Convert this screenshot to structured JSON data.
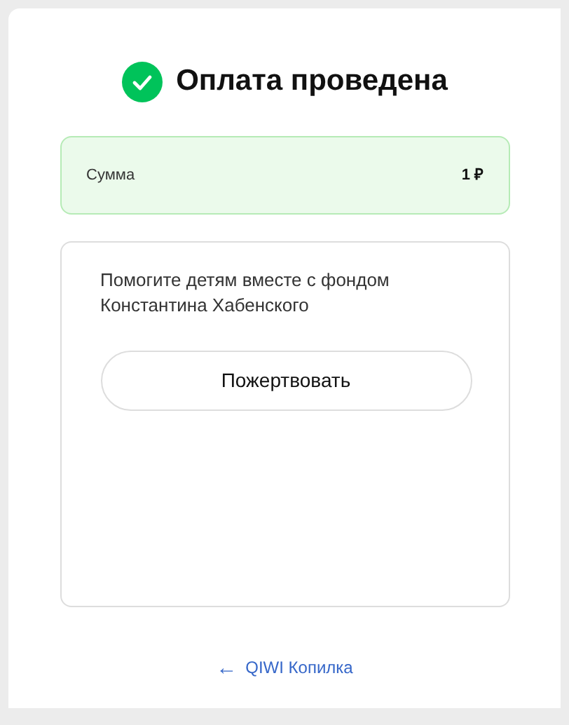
{
  "title": "Оплата проведена",
  "summary": {
    "label": "Сумма",
    "value": "1 ₽"
  },
  "donation": {
    "text": "Помогите детям вместе с фондом Константина Хабенского",
    "button": "Пожертвовать"
  },
  "back_link": {
    "arrow": "←",
    "label": "QIWI Копилка"
  }
}
